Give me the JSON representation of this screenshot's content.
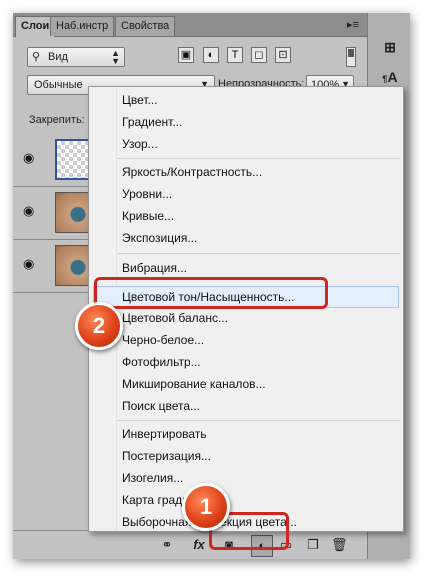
{
  "tabs": [
    "Слои",
    "Наб.инстр",
    "Свойства"
  ],
  "panel_menu_icon": "panel-menu-icon",
  "filter_select": {
    "value": "Вид",
    "icon": "search-icon"
  },
  "filter_icons": [
    "image-filter-icon",
    "adjustment-filter-icon",
    "text-filter-icon",
    "shape-filter-icon",
    "smart-object-filter-icon"
  ],
  "blend_mode": {
    "value": "Обычные"
  },
  "opacity": {
    "label": "Непрозрачность:",
    "value": "100%"
  },
  "lock": {
    "label": "Закрепить:"
  },
  "layers": [
    {
      "kind": "transparent",
      "eye": "eye-icon"
    },
    {
      "kind": "photo",
      "eye": "eye-icon"
    },
    {
      "kind": "photo",
      "eye": "eye-icon"
    }
  ],
  "bottom_icons": [
    "link-icon",
    "fx-icon",
    "mask-icon",
    "adjustment-layer-icon",
    "folder-icon",
    "new-layer-icon",
    "trash-icon"
  ],
  "bottom_fx_label": "fx",
  "right_strip_icons": [
    "brush-settings-icon",
    "character-icon"
  ],
  "right_strip_char": "A",
  "context_menu": {
    "groups": [
      [
        "Цвет...",
        "Градиент...",
        "Узор..."
      ],
      [
        "Яркость/Контрастность...",
        "Уровни...",
        "Кривые...",
        "Экспозиция..."
      ],
      [
        "Вибрация...",
        "Цветовой тон/Насыщенность...",
        "Цветовой баланс...",
        "Черно-белое...",
        "Фотофильтр...",
        "Микширование каналов...",
        "Поиск цвета..."
      ],
      [
        "Инвертировать",
        "Постеризация...",
        "Изогелия...",
        "Карта градиента...",
        "Выборочная коррекция цвета..."
      ]
    ],
    "highlighted": "Цветовой тон/Насыщенность..."
  },
  "callouts": [
    {
      "number": "1"
    },
    {
      "number": "2"
    }
  ],
  "colors": {
    "accent": "#d0261f",
    "badge": "#e0431b",
    "menu_bg": "#f0f0f0",
    "panel_bg": "#c2c2c2"
  }
}
